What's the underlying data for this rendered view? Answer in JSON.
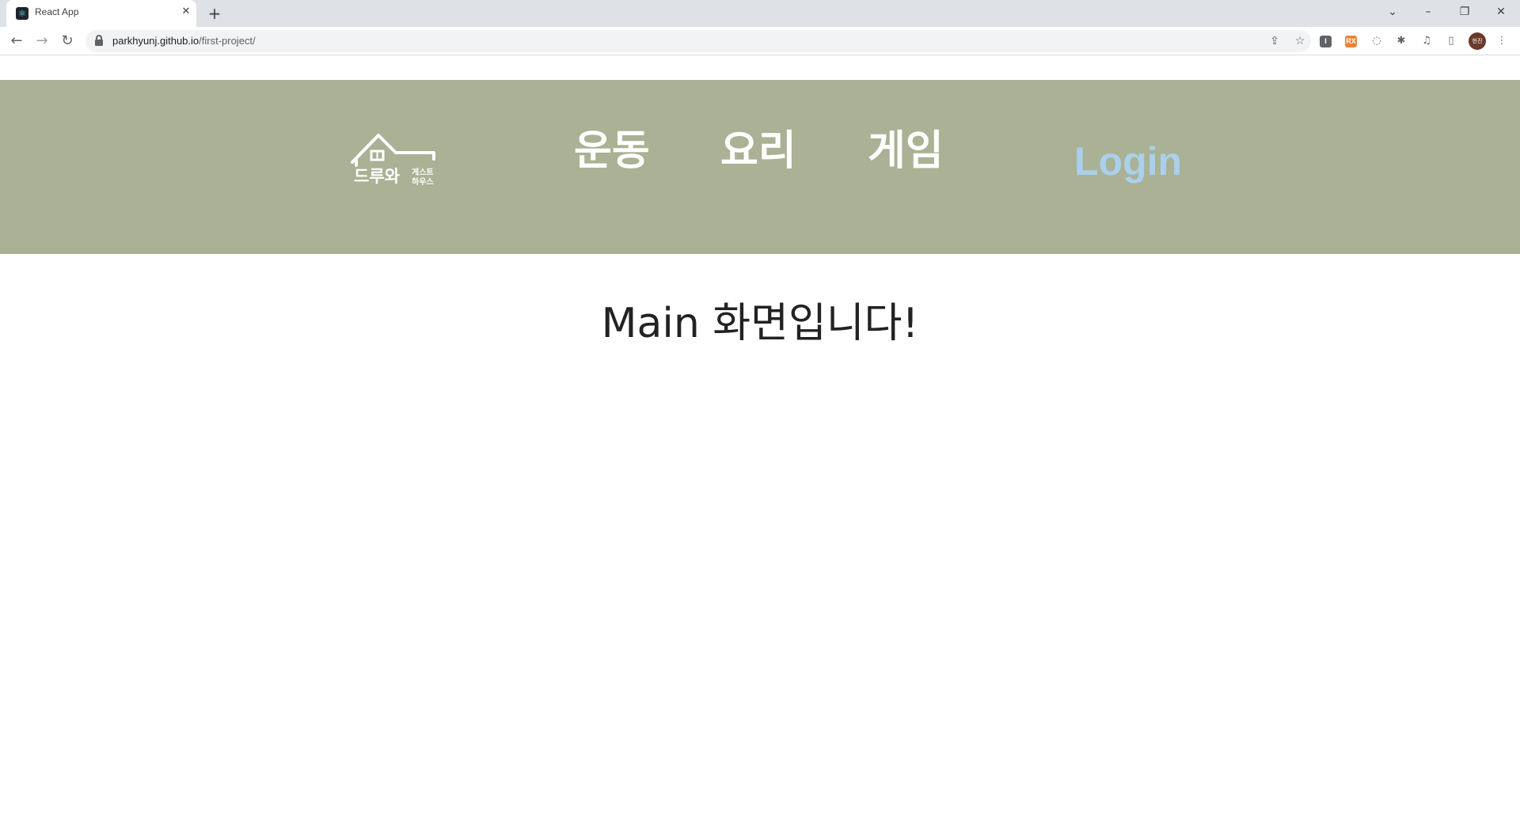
{
  "browser": {
    "tab_title": "React App",
    "url_host": "parkhyunj.github.io",
    "url_path": "/first-project/",
    "profile_initials": "현진",
    "extensions": [
      "I",
      "RX"
    ]
  },
  "header": {
    "logo": {
      "text_main": "드루와",
      "text_sub_1": "게스트",
      "text_sub_2": "하우스"
    },
    "nav": [
      {
        "label": "운동"
      },
      {
        "label": "요리"
      },
      {
        "label": "게임"
      }
    ],
    "login_label": "Login",
    "background_color": "#aab194",
    "login_color": "#a9d0ec"
  },
  "main": {
    "title": "Main 화면입니다!"
  }
}
